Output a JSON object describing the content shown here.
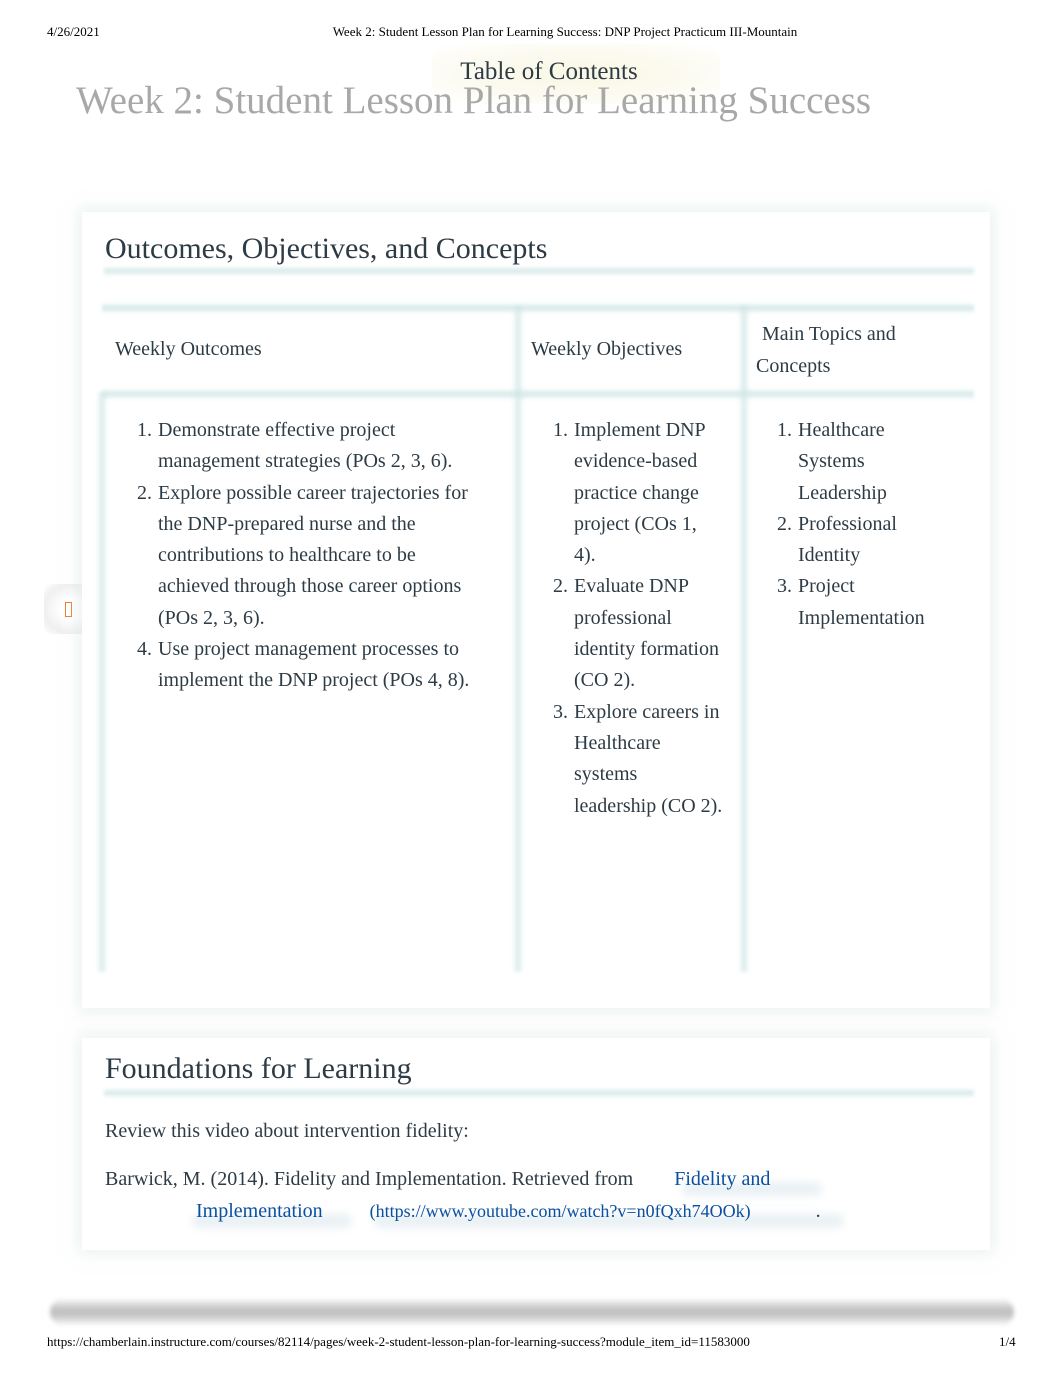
{
  "print_header": {
    "date": "4/26/2021",
    "title": "Week 2: Student Lesson Plan for Learning Success: DNP Project Practicum III-Mountain"
  },
  "toc_label": "Table of Contents",
  "page_title": "Week 2: Student Lesson Plan for Learning Success",
  "outcomes_section": {
    "heading": "Outcomes, Objectives, and Concepts",
    "columns": [
      {
        "header": "Weekly Outcomes",
        "items": [
          {
            "number": 1,
            "text": "Demonstrate effective project management strategies (POs 2, 3, 6)."
          },
          {
            "number": 2,
            "text": "Explore possible career trajectories for the DNP-prepared nurse and the contributions to healthcare to be achieved through those career options (POs 2, 3, 6)."
          },
          {
            "number": 4,
            "text": "Use project management processes to implement the DNP project (POs 4, 8)."
          }
        ]
      },
      {
        "header": "Weekly Objectives",
        "items": [
          {
            "number": 1,
            "text": "Implement DNP evidence-based practice change project (COs 1, 4)."
          },
          {
            "number": 2,
            "text": "Evaluate DNP professional identity formation (CO 2)."
          },
          {
            "number": 3,
            "text": "Explore careers in Healthcare systems leadership (CO 2)."
          }
        ]
      },
      {
        "header": "Main Topics and Concepts",
        "items": [
          {
            "number": 1,
            "text": "Healthcare Systems Leadership"
          },
          {
            "number": 2,
            "text": "Professional Identity"
          },
          {
            "number": 3,
            "text": "Project Implementation"
          }
        ]
      }
    ]
  },
  "foundations_section": {
    "heading": "Foundations for Learning",
    "intro": "Review this video about intervention fidelity:",
    "citation_prefix": "Barwick, M. (2014). Fidelity and Implementation. Retrieved from",
    "link_text_line1": "Fidelity and",
    "link_text_line2": "Implementation",
    "link_url": "(https://www.youtube.com/watch?v=n0fQxh74OOk)",
    "citation_suffix": "."
  },
  "side_button": {
    "icon": "bookmark-icon"
  },
  "colors": {
    "text": "#2d3b45",
    "title_gray": "#a8a8a8",
    "link": "#0a4fa0",
    "accent_orange": "#f07b2f",
    "rule_teal": "#cee4e4"
  },
  "print_footer": {
    "url": "https://chamberlain.instructure.com/courses/82114/pages/week-2-student-lesson-plan-for-learning-success?module_item_id=11583000",
    "page": "1/4"
  }
}
